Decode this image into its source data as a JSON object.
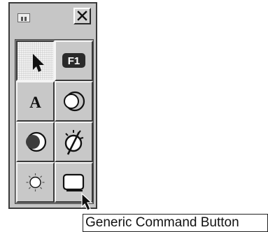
{
  "palette": {
    "tools": [
      {
        "id": "select",
        "icon": "arrow-pointer-icon",
        "pressed": true
      },
      {
        "id": "function-key",
        "icon": "function-key-icon",
        "label": "F1"
      },
      {
        "id": "text",
        "icon": "text-icon",
        "label": "A"
      },
      {
        "id": "crescent",
        "icon": "crescent-moon-icon"
      },
      {
        "id": "eclipse",
        "icon": "eclipse-icon"
      },
      {
        "id": "no-light",
        "icon": "light-off-icon"
      },
      {
        "id": "light",
        "icon": "sun-icon"
      },
      {
        "id": "command-button",
        "icon": "command-button-icon"
      }
    ]
  },
  "tooltip": {
    "text": "Generic Command Button"
  },
  "colors": {
    "face": "#c6c6c6",
    "shadow": "#3a3a3a",
    "highlight": "#ffffff"
  }
}
